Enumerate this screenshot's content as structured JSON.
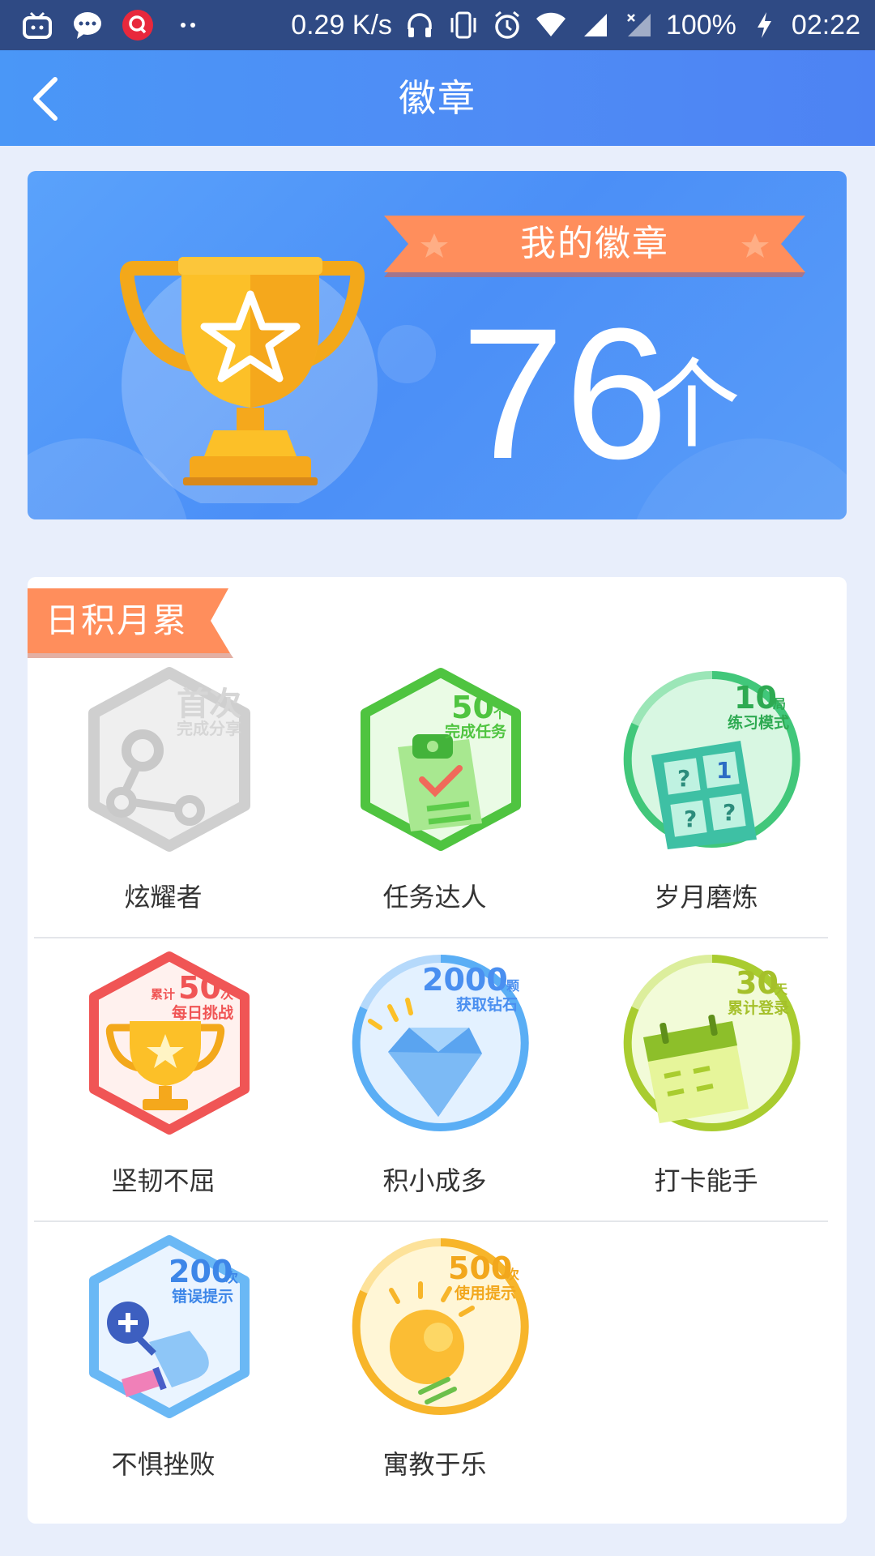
{
  "status_bar": {
    "speed": "0.29 K/s",
    "battery": "100%",
    "time": "02:22"
  },
  "header": {
    "title": "徽章"
  },
  "summary": {
    "label": "我的徽章",
    "count": "76",
    "unit": "个"
  },
  "section": {
    "title": "日积月累"
  },
  "badges": [
    {
      "name": "炫耀者",
      "num": "首次",
      "unit": "",
      "desc": "完成分享",
      "color": "#c8c8c8",
      "shape": "hex",
      "earned": false
    },
    {
      "name": "任务达人",
      "num": "50",
      "unit": "个",
      "desc": "完成任务",
      "color": "#4fc440",
      "shape": "hex",
      "earned": true
    },
    {
      "name": "岁月磨炼",
      "num": "10",
      "unit": "局",
      "desc": "练习模式",
      "color": "#41c77a",
      "shape": "circle",
      "earned": true
    },
    {
      "name": "坚韧不屈",
      "num": "50",
      "unit": "次",
      "desc": "每日挑战",
      "prefix": "累计",
      "color": "#f05555",
      "shape": "hex",
      "earned": true
    },
    {
      "name": "积小成多",
      "num": "2000",
      "unit": "颗",
      "desc": "获取钻石",
      "color": "#4a8ff0",
      "shape": "circle",
      "earned": true
    },
    {
      "name": "打卡能手",
      "num": "30",
      "unit": "天",
      "desc": "累计登录",
      "color": "#a9cc2f",
      "shape": "circle",
      "earned": true
    },
    {
      "name": "不惧挫败",
      "num": "200",
      "unit": "次",
      "desc": "错误提示",
      "color": "#3d86e8",
      "shape": "hex",
      "earned": true
    },
    {
      "name": "寓教于乐",
      "num": "500",
      "unit": "次",
      "desc": "使用提示",
      "color": "#f7b52a",
      "shape": "circle",
      "earned": true
    }
  ]
}
